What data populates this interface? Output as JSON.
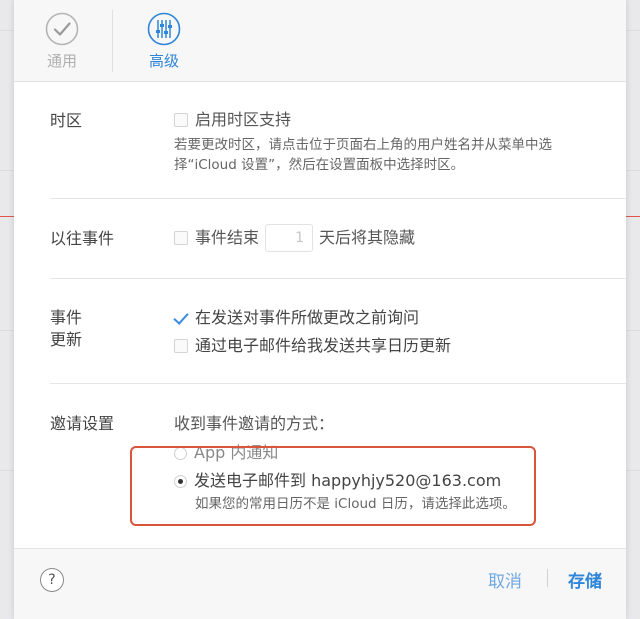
{
  "tabs": {
    "general": {
      "label": "通用",
      "icon": "checkmark-circle-icon"
    },
    "advanced": {
      "label": "高级",
      "icon": "sliders-icon"
    }
  },
  "timezone": {
    "label": "时区",
    "checkbox_label": "启用时区支持",
    "checked": false,
    "help_line1": "若要更改时区，请点击位于页面右上角的用户姓名并从菜单中选",
    "help_line2": "择“iCloud 设置”，然后在设置面板中选择时区。"
  },
  "past_events": {
    "label": "以往事件",
    "prefix": "事件结束",
    "days_value": "1",
    "suffix": "天后将其隐藏",
    "checked": false
  },
  "event_updates": {
    "label_line1": "事件",
    "label_line2": "更新",
    "option1": "在发送对事件所做更改之前询问",
    "option1_checked": true,
    "option2": "通过电子邮件给我发送共享日历更新",
    "option2_checked": false
  },
  "invitations": {
    "label": "邀请设置",
    "heading": "收到事件邀请的方式：",
    "option_app": "App 内通知",
    "option_email": "发送电子邮件到 happyhjy520@163.com",
    "selected": "email",
    "email_help": "如果您的常用日历不是 iCloud 日历，请选择此选项。"
  },
  "footer": {
    "help": "?",
    "cancel": "取消",
    "save": "存储"
  },
  "colors": {
    "accent": "#2f85d8",
    "highlight": "#d8553b"
  }
}
